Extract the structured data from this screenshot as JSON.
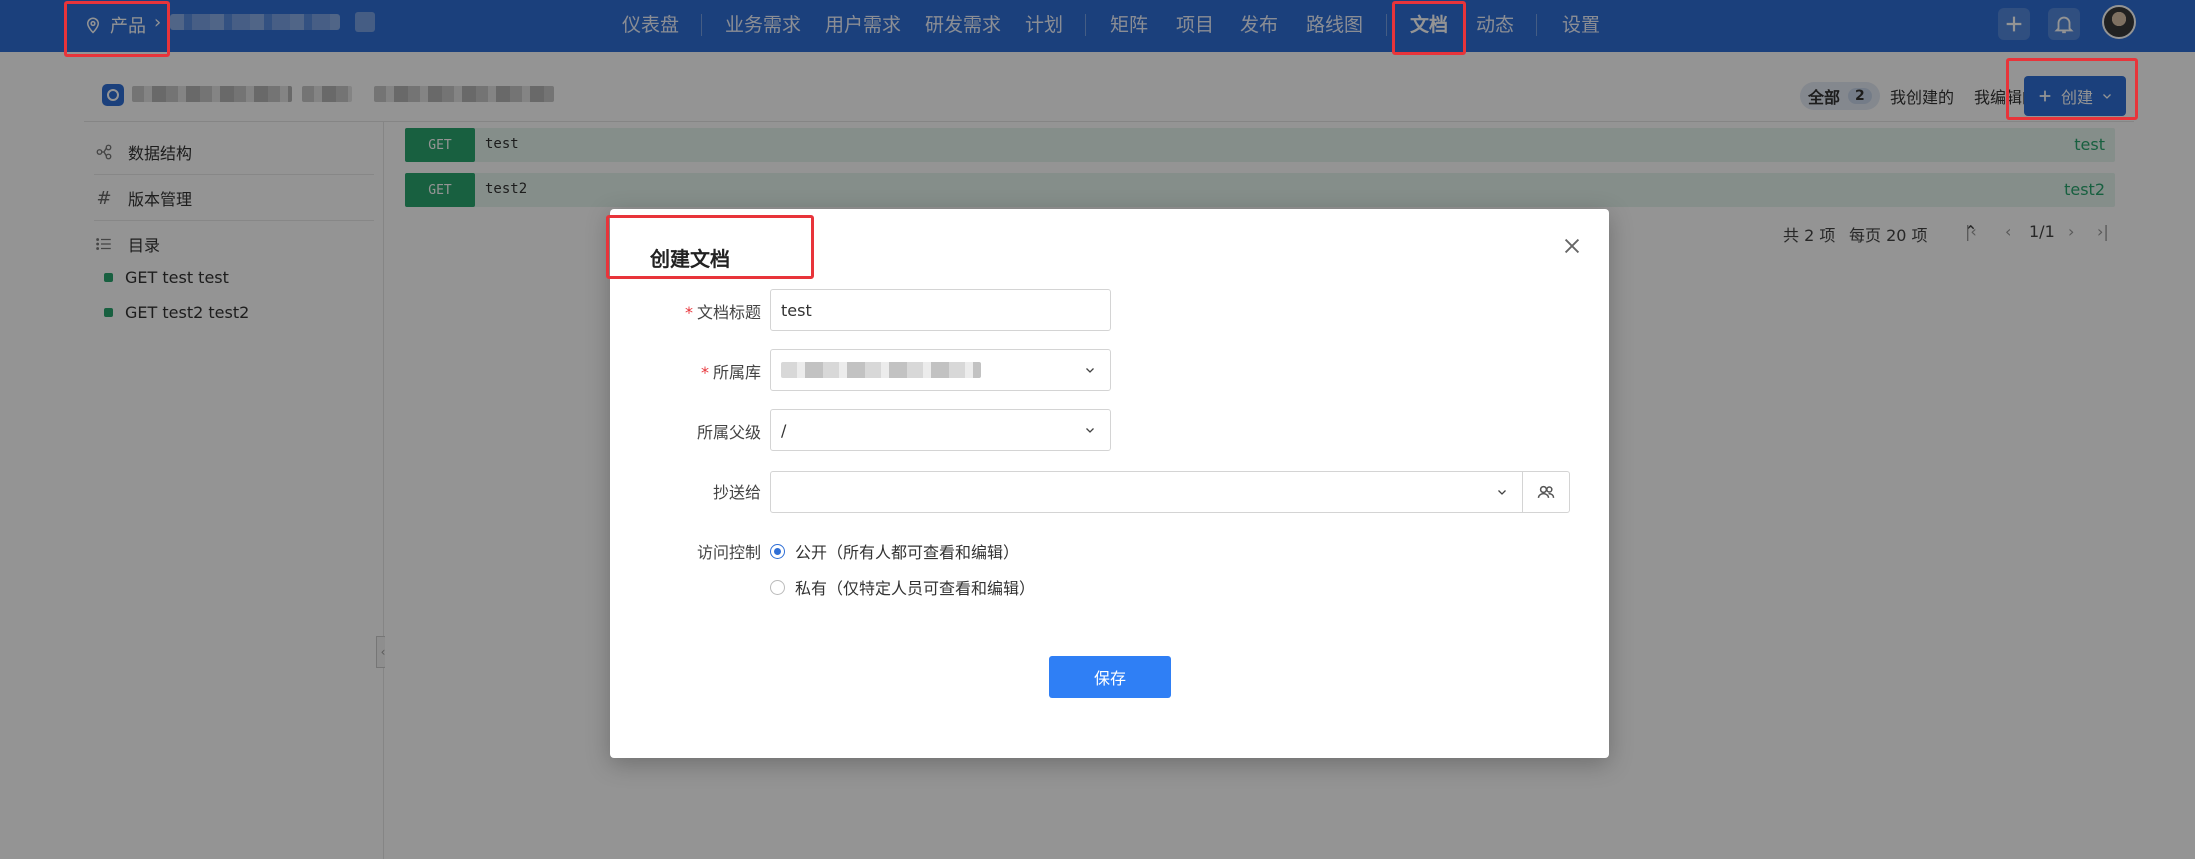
{
  "topbar": {
    "breadcrumb_root": "产品",
    "breadcrumb_sep": "›",
    "nav": [
      "仪表盘",
      "业务需求",
      "用户需求",
      "研发需求",
      "计划",
      "矩阵",
      "项目",
      "发布",
      "路线图",
      "文档",
      "动态",
      "设置"
    ],
    "active_nav": "文档"
  },
  "subbar": {
    "filters": {
      "all_label": "全部",
      "all_count": "2",
      "created_by_me": "我创建的",
      "edited_by_me": "我编辑的"
    },
    "create_label": "创建"
  },
  "sidebar": {
    "items": [
      {
        "label": "数据结构",
        "icon": "schema-icon"
      },
      {
        "label": "版本管理",
        "icon": "hash-icon"
      },
      {
        "label": "目录",
        "icon": "list-icon"
      }
    ],
    "tree": [
      "GET test test",
      "GET test2 test2"
    ]
  },
  "apis": [
    {
      "method": "GET",
      "path": "test",
      "name": "test"
    },
    {
      "method": "GET",
      "path": "test2",
      "name": "test2"
    }
  ],
  "pager": {
    "total": "共 2 项",
    "page_size": "每页 20 项",
    "page": "1/1"
  },
  "modal": {
    "title": "创建文档",
    "title_label": "文档标题",
    "title_value": "test",
    "repo_label": "所属库",
    "parent_label": "所属父级",
    "parent_value": "/",
    "cc_label": "抄送给",
    "access_label": "访问控制",
    "access_public": "公开（所有人都可查看和编辑）",
    "access_private": "私有（仅特定人员可查看和编辑）",
    "access_selected": "public",
    "save_label": "保存"
  },
  "colors": {
    "brand": "#2f6fd6",
    "get_method": "#2aa56e",
    "annotation": "#e8343a"
  }
}
